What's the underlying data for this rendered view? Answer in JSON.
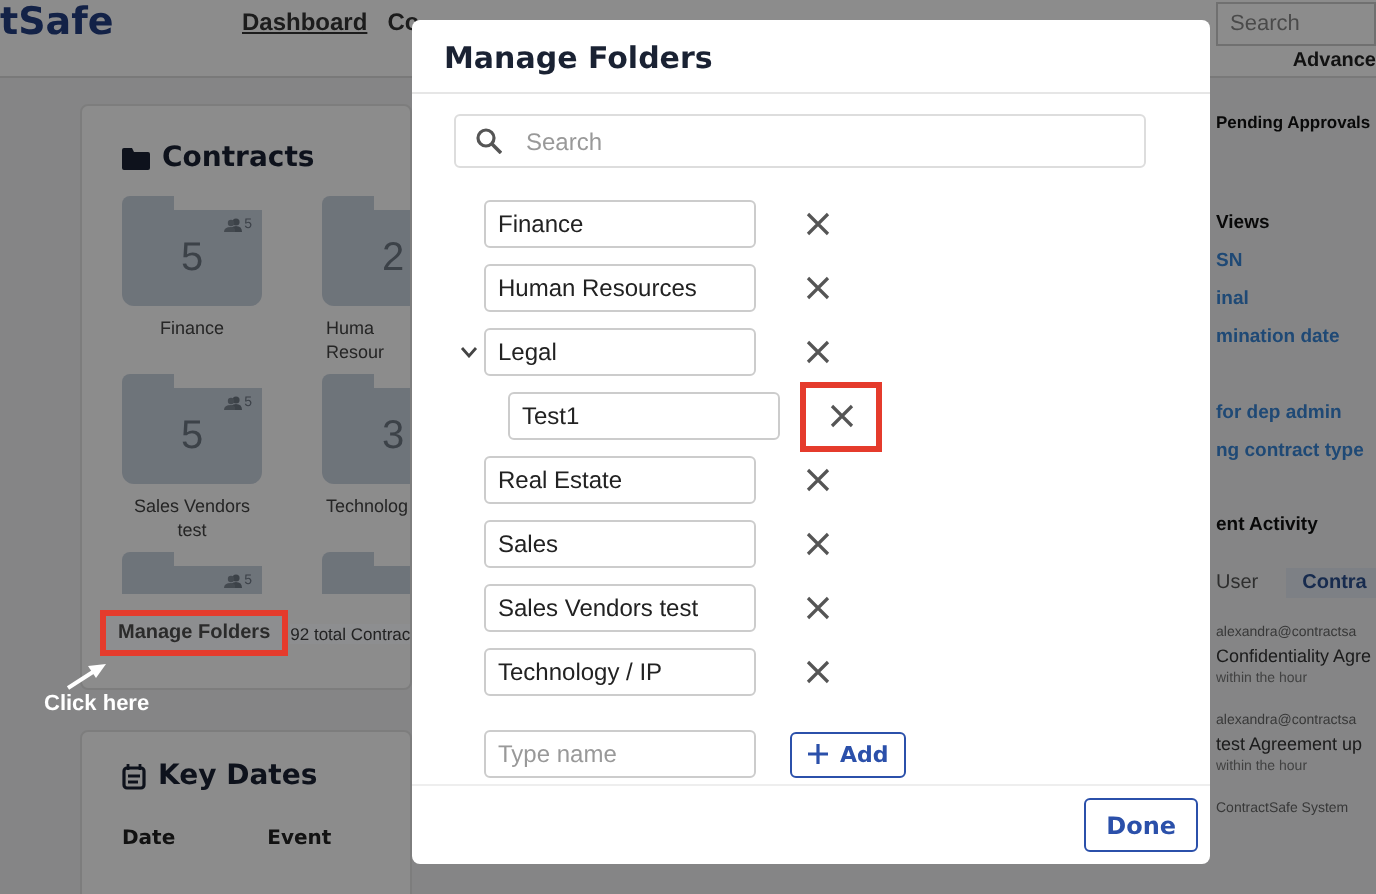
{
  "header": {
    "logo": "tSafe",
    "nav": [
      {
        "label": "Dashboard",
        "selected": true
      },
      {
        "label": "Co",
        "selected": false
      }
    ],
    "search": {
      "placeholder": "Search"
    },
    "advanced": "Advance"
  },
  "contracts": {
    "title": "Contracts",
    "folders": [
      {
        "kind": "full",
        "count": "5",
        "members": "5",
        "name": "Finance"
      },
      {
        "kind": "cut",
        "count": "2",
        "name": "Huma Resour"
      },
      {
        "kind": "full",
        "count": "5",
        "members": "5",
        "name": "Sales Vendors test"
      },
      {
        "kind": "cut",
        "count": "3",
        "name": "Technolog"
      },
      {
        "kind": "partial",
        "members": "5"
      },
      {
        "kind": "partial"
      }
    ],
    "manage_link": {
      "label": "Manage Folders",
      "highlighted": true
    },
    "total": "92 total Contrac"
  },
  "annotation": {
    "label": "Click here"
  },
  "key_dates": {
    "title": "Key Dates",
    "columns": [
      "Date",
      "Event"
    ]
  },
  "side": {
    "pending_title": "Pending Approvals",
    "views_title": "Views",
    "views": [
      "SN",
      "inal",
      "mination date",
      "for dep admin",
      "ng contract type"
    ],
    "activity_title": "ent Activity",
    "activity_tabs": [
      {
        "label": "User",
        "selected": false
      },
      {
        "label": "Contra",
        "selected": true
      }
    ],
    "activity": [
      {
        "user": "alexandra@contractsa",
        "text": "Confidentiality Agre",
        "time": "within the hour"
      },
      {
        "user": "alexandra@contractsa",
        "text": "test Agreement up",
        "time": "within the hour"
      },
      {
        "user": "ContractSafe System"
      }
    ]
  },
  "modal": {
    "title": "Manage Folders",
    "search": {
      "placeholder": "Search"
    },
    "folders": [
      {
        "name": "Finance",
        "highlighted": false
      },
      {
        "name": "Human Resources",
        "highlighted": false
      },
      {
        "name": "Legal",
        "highlighted": false,
        "expanded": true,
        "children": [
          {
            "name": "Test1",
            "highlighted": true
          }
        ]
      },
      {
        "name": "Real Estate",
        "highlighted": false
      },
      {
        "name": "Sales",
        "highlighted": false
      },
      {
        "name": "Sales Vendors test",
        "highlighted": false
      },
      {
        "name": "Technology / IP",
        "highlighted": false
      }
    ],
    "new_folder": {
      "placeholder": "Type name"
    },
    "add_button": "Add",
    "done_button": "Done"
  }
}
